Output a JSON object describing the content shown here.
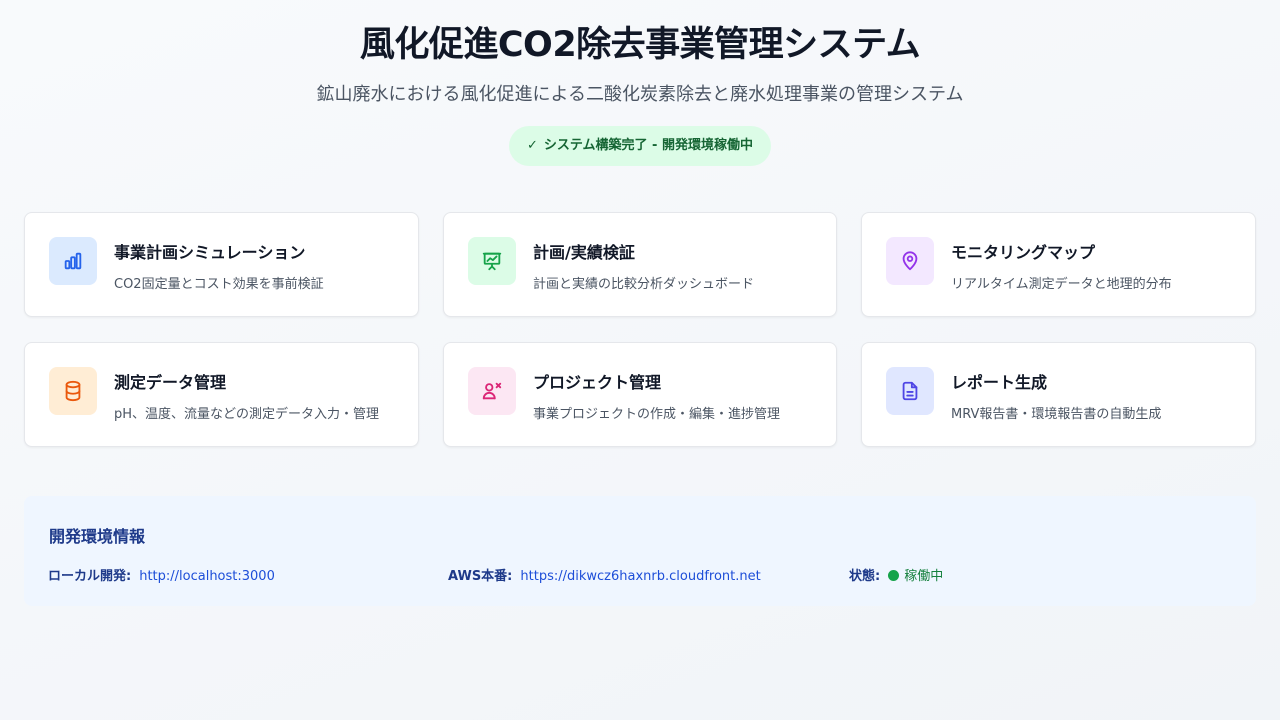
{
  "header": {
    "title": "風化促進CO2除去事業管理システム",
    "subtitle": "鉱山廃水における風化促進による二酸化炭素除去と廃水処理事業の管理システム",
    "status_check": "✓",
    "status_badge": "システム構築完了 - 開発環境稼働中"
  },
  "cards": [
    {
      "title": "事業計画シミュレーション",
      "description": "CO2固定量とコスト効果を事前検証",
      "icon": "bar-chart-icon",
      "icon_color": "#2563eb",
      "icon_bg": "#dbeafe"
    },
    {
      "title": "計画/実績検証",
      "description": "計画と実績の比較分析ダッシュボード",
      "icon": "presentation-chart-icon",
      "icon_color": "#16a34a",
      "icon_bg": "#dcfce7"
    },
    {
      "title": "モニタリングマップ",
      "description": "リアルタイム測定データと地理的分布",
      "icon": "map-pin-icon",
      "icon_color": "#9333ea",
      "icon_bg": "#f3e8ff"
    },
    {
      "title": "測定データ管理",
      "description": "pH、温度、流量などの測定データ入力・管理",
      "icon": "database-icon",
      "icon_color": "#ea580c",
      "icon_bg": "#ffedd5"
    },
    {
      "title": "プロジェクト管理",
      "description": "事業プロジェクトの作成・編集・進捗管理",
      "icon": "users-cog-icon",
      "icon_color": "#db2777",
      "icon_bg": "#fce7f3"
    },
    {
      "title": "レポート生成",
      "description": "MRV報告書・環境報告書の自動生成",
      "icon": "document-icon",
      "icon_color": "#4f46e5",
      "icon_bg": "#e0e7ff"
    }
  ],
  "dev_info": {
    "title": "開発環境情報",
    "local_label": "ローカル開発:",
    "local_url": "http://localhost:3000",
    "aws_label": "AWS本番:",
    "aws_url": "https://dikwcz6haxnrb.cloudfront.net",
    "status_label": "状態:",
    "status_value": "稼働中",
    "status_color": "#16a34a"
  }
}
